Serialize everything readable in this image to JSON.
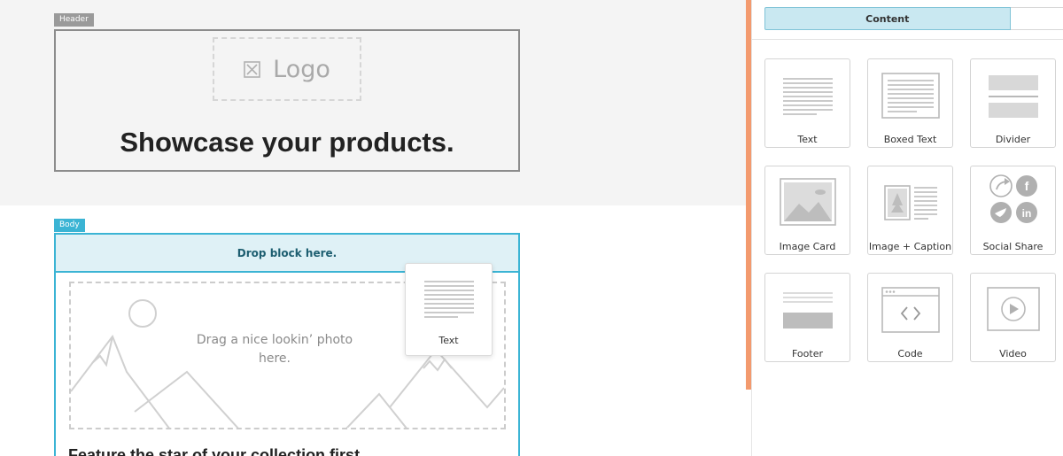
{
  "canvas": {
    "header_tag": "Header",
    "logo_text": "Logo",
    "headline": "Showcase your products.",
    "body_tag": "Body",
    "drop_bar": "Drop block here.",
    "photo_placeholder": "Drag a nice lookin’ photo here.",
    "feature_text": "Feature the star of your collection first."
  },
  "drag_ghost": {
    "label": "Text",
    "icon": "text-block-icon"
  },
  "panel": {
    "tabs": [
      {
        "label": "Content",
        "active": true
      },
      {
        "label": "",
        "active": false
      }
    ],
    "blocks": [
      {
        "label": "Text",
        "icon": "text-block-icon"
      },
      {
        "label": "Boxed Text",
        "icon": "boxed-text-icon"
      },
      {
        "label": "Divider",
        "icon": "divider-icon"
      },
      {
        "label": "Image Card",
        "icon": "image-card-icon"
      },
      {
        "label": "Image + Caption",
        "icon": "image-caption-icon"
      },
      {
        "label": "Social Share",
        "icon": "social-share-icon"
      },
      {
        "label": "Footer",
        "icon": "footer-icon"
      },
      {
        "label": "Code",
        "icon": "code-icon"
      },
      {
        "label": "Video",
        "icon": "video-icon"
      }
    ]
  },
  "colors": {
    "accent_blue": "#3bb4d4",
    "accent_orange": "#f39a6e",
    "header_tag_grey": "#9a9a9a"
  }
}
